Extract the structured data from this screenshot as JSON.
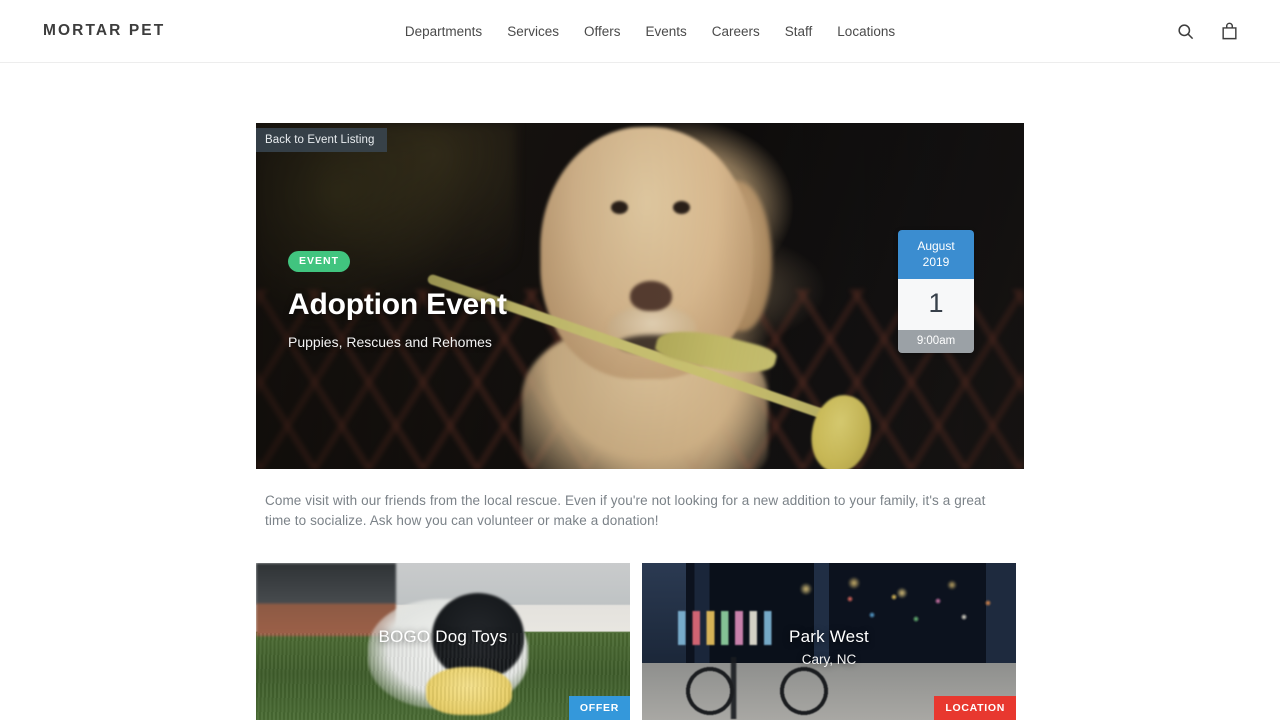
{
  "header": {
    "brand": "MORTAR PET",
    "nav": [
      {
        "label": "Departments"
      },
      {
        "label": "Services"
      },
      {
        "label": "Offers"
      },
      {
        "label": "Events"
      },
      {
        "label": "Careers"
      },
      {
        "label": "Staff"
      },
      {
        "label": "Locations"
      }
    ],
    "icons": {
      "search": "search-icon",
      "cart": "shopping-bag-icon"
    }
  },
  "hero": {
    "back_link": "Back to Event Listing",
    "badge": "EVENT",
    "title": "Adoption Event",
    "subtitle": "Puppies, Rescues and Rehomes",
    "date_card": {
      "month": "August",
      "year": "2019",
      "day": "1",
      "time": "9:00am",
      "month_color": "#3b8dd0",
      "time_color": "#9ba1a6"
    },
    "badge_color": "#41c47f"
  },
  "description": "Come visit with our friends from the local rescue. Even if you're not looking for a new addition to your family, it's a great time to socialize. Ask how you can volunteer or make a donation!",
  "cards": [
    {
      "title": "BOGO Dog Toys",
      "subtitle": "",
      "badge": "OFFER",
      "badge_color": "#3498db"
    },
    {
      "title": "Park West",
      "subtitle": "Cary, NC",
      "badge": "LOCATION",
      "badge_color": "#e8382f"
    }
  ]
}
